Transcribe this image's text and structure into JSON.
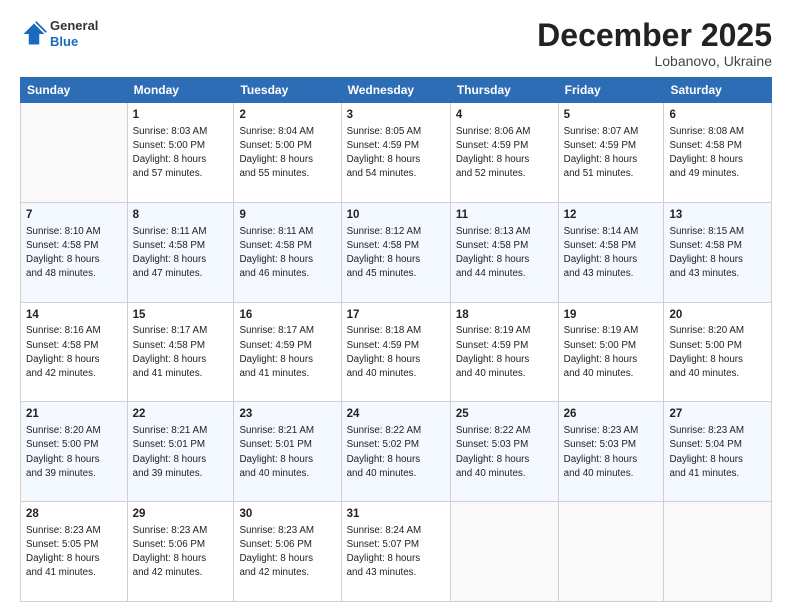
{
  "logo": {
    "general": "General",
    "blue": "Blue"
  },
  "title": "December 2025",
  "location": "Lobanovo, Ukraine",
  "days_header": [
    "Sunday",
    "Monday",
    "Tuesday",
    "Wednesday",
    "Thursday",
    "Friday",
    "Saturday"
  ],
  "weeks": [
    [
      {
        "day": "",
        "info": ""
      },
      {
        "day": "1",
        "info": "Sunrise: 8:03 AM\nSunset: 5:00 PM\nDaylight: 8 hours\nand 57 minutes."
      },
      {
        "day": "2",
        "info": "Sunrise: 8:04 AM\nSunset: 5:00 PM\nDaylight: 8 hours\nand 55 minutes."
      },
      {
        "day": "3",
        "info": "Sunrise: 8:05 AM\nSunset: 4:59 PM\nDaylight: 8 hours\nand 54 minutes."
      },
      {
        "day": "4",
        "info": "Sunrise: 8:06 AM\nSunset: 4:59 PM\nDaylight: 8 hours\nand 52 minutes."
      },
      {
        "day": "5",
        "info": "Sunrise: 8:07 AM\nSunset: 4:59 PM\nDaylight: 8 hours\nand 51 minutes."
      },
      {
        "day": "6",
        "info": "Sunrise: 8:08 AM\nSunset: 4:58 PM\nDaylight: 8 hours\nand 49 minutes."
      }
    ],
    [
      {
        "day": "7",
        "info": ""
      },
      {
        "day": "8",
        "info": "Sunrise: 8:11 AM\nSunset: 4:58 PM\nDaylight: 8 hours\nand 47 minutes."
      },
      {
        "day": "9",
        "info": "Sunrise: 8:11 AM\nSunset: 4:58 PM\nDaylight: 8 hours\nand 46 minutes."
      },
      {
        "day": "10",
        "info": "Sunrise: 8:12 AM\nSunset: 4:58 PM\nDaylight: 8 hours\nand 45 minutes."
      },
      {
        "day": "11",
        "info": "Sunrise: 8:13 AM\nSunset: 4:58 PM\nDaylight: 8 hours\nand 44 minutes."
      },
      {
        "day": "12",
        "info": "Sunrise: 8:14 AM\nSunset: 4:58 PM\nDaylight: 8 hours\nand 43 minutes."
      },
      {
        "day": "13",
        "info": "Sunrise: 8:15 AM\nSunset: 4:58 PM\nDaylight: 8 hours\nand 43 minutes."
      }
    ],
    [
      {
        "day": "14",
        "info": ""
      },
      {
        "day": "15",
        "info": "Sunrise: 8:17 AM\nSunset: 4:58 PM\nDaylight: 8 hours\nand 41 minutes."
      },
      {
        "day": "16",
        "info": "Sunrise: 8:17 AM\nSunset: 4:59 PM\nDaylight: 8 hours\nand 41 minutes."
      },
      {
        "day": "17",
        "info": "Sunrise: 8:18 AM\nSunset: 4:59 PM\nDaylight: 8 hours\nand 40 minutes."
      },
      {
        "day": "18",
        "info": "Sunrise: 8:19 AM\nSunset: 4:59 PM\nDaylight: 8 hours\nand 40 minutes."
      },
      {
        "day": "19",
        "info": "Sunrise: 8:19 AM\nSunset: 5:00 PM\nDaylight: 8 hours\nand 40 minutes."
      },
      {
        "day": "20",
        "info": "Sunrise: 8:20 AM\nSunset: 5:00 PM\nDaylight: 8 hours\nand 40 minutes."
      }
    ],
    [
      {
        "day": "21",
        "info": ""
      },
      {
        "day": "22",
        "info": "Sunrise: 8:21 AM\nSunset: 5:01 PM\nDaylight: 8 hours\nand 39 minutes."
      },
      {
        "day": "23",
        "info": "Sunrise: 8:21 AM\nSunset: 5:01 PM\nDaylight: 8 hours\nand 40 minutes."
      },
      {
        "day": "24",
        "info": "Sunrise: 8:22 AM\nSunset: 5:02 PM\nDaylight: 8 hours\nand 40 minutes."
      },
      {
        "day": "25",
        "info": "Sunrise: 8:22 AM\nSunset: 5:03 PM\nDaylight: 8 hours\nand 40 minutes."
      },
      {
        "day": "26",
        "info": "Sunrise: 8:23 AM\nSunset: 5:03 PM\nDaylight: 8 hours\nand 40 minutes."
      },
      {
        "day": "27",
        "info": "Sunrise: 8:23 AM\nSunset: 5:04 PM\nDaylight: 8 hours\nand 41 minutes."
      }
    ],
    [
      {
        "day": "28",
        "info": "Sunrise: 8:23 AM\nSunset: 5:05 PM\nDaylight: 8 hours\nand 41 minutes."
      },
      {
        "day": "29",
        "info": "Sunrise: 8:23 AM\nSunset: 5:06 PM\nDaylight: 8 hours\nand 42 minutes."
      },
      {
        "day": "30",
        "info": "Sunrise: 8:23 AM\nSunset: 5:06 PM\nDaylight: 8 hours\nand 42 minutes."
      },
      {
        "day": "31",
        "info": "Sunrise: 8:24 AM\nSunset: 5:07 PM\nDaylight: 8 hours\nand 43 minutes."
      },
      {
        "day": "",
        "info": ""
      },
      {
        "day": "",
        "info": ""
      },
      {
        "day": "",
        "info": ""
      }
    ]
  ],
  "week7_sunday_info": "Sunrise: 8:10 AM\nSunset: 4:58 PM\nDaylight: 8 hours\nand 48 minutes.",
  "week14_sunday_info": "Sunrise: 8:16 AM\nSunset: 4:58 PM\nDaylight: 8 hours\nand 42 minutes.",
  "week21_sunday_info": "Sunrise: 8:20 AM\nSunset: 5:00 PM\nDaylight: 8 hours\nand 39 minutes."
}
